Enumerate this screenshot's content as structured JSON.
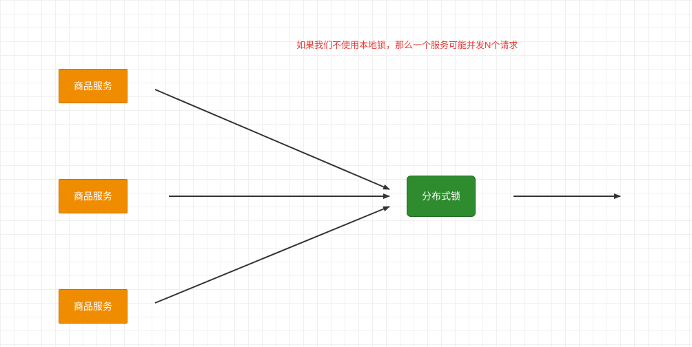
{
  "caption": "如果我们不使用本地锁，那么一个服务可能并发N个请求",
  "nodes": {
    "service1": "商品服务",
    "service2": "商品服务",
    "service3": "商品服务",
    "lock": "分布式锁"
  }
}
